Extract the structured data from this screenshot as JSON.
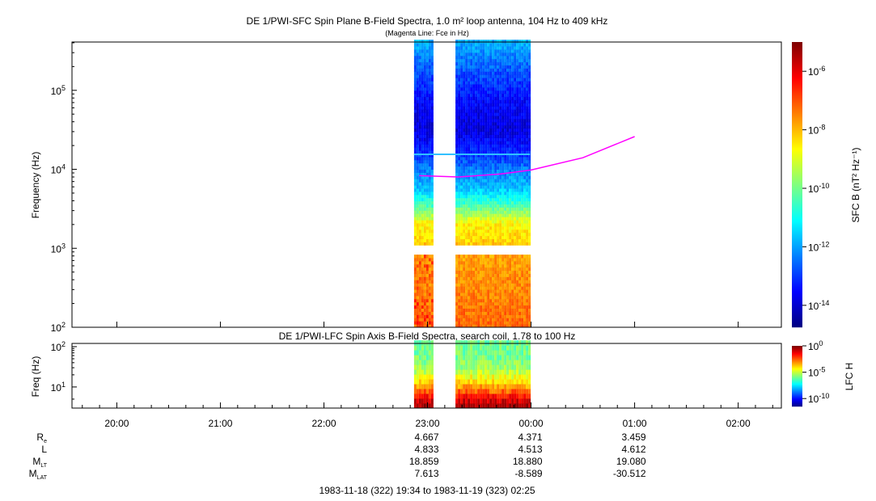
{
  "chart_data": [
    {
      "type": "heatmap",
      "title": "DE 1/PWI-SFC  Spin Plane B-Field Spectra, 1.0 m² loop antenna, 104 Hz to 409 kHz",
      "subtitle": "(Magenta Line: Fce in Hz)",
      "ylabel": "Frequency (Hz)",
      "yscale": "log",
      "ylim": [
        100,
        409000
      ],
      "yticks": [
        {
          "v": 2,
          "label": "10",
          "exp": "2"
        },
        {
          "v": 3,
          "label": "10",
          "exp": "3"
        },
        {
          "v": 4,
          "label": "10",
          "exp": "4"
        },
        {
          "v": 5,
          "label": "10",
          "exp": "5"
        }
      ],
      "colorbar": {
        "label": "SFC B (nT² Hz⁻¹)",
        "log_range": [
          -14.75,
          -5
        ],
        "ticks": [
          {
            "v": -6,
            "label": "10",
            "exp": "-6"
          },
          {
            "v": -8,
            "label": "10",
            "exp": "-8"
          },
          {
            "v": -10,
            "label": "10",
            "exp": "-10"
          },
          {
            "v": -12,
            "label": "10",
            "exp": "-12"
          },
          {
            "v": -14,
            "label": "10",
            "exp": "-14"
          }
        ]
      },
      "data_segments_hours": [
        [
          22.87,
          23.05
        ],
        [
          23.27,
          23.99
        ]
      ],
      "freq_gap_hz": [
        880,
        1070
      ],
      "spectrum_profile_log": [
        [
          2.0,
          -7.2
        ],
        [
          2.5,
          -7.5
        ],
        [
          2.95,
          -7.8
        ],
        [
          3.05,
          -8.2
        ],
        [
          3.3,
          -8.6
        ],
        [
          3.5,
          -10.2
        ],
        [
          3.7,
          -11.5
        ],
        [
          4.0,
          -12.4
        ],
        [
          4.2,
          -13.2
        ],
        [
          4.5,
          -13.9
        ],
        [
          4.8,
          -13.6
        ],
        [
          5.2,
          -12.8
        ],
        [
          5.61,
          -11.8
        ]
      ],
      "fce_line": {
        "name": "Fce",
        "color": "#ff00ff",
        "points_hours_hz": [
          [
            22.92,
            8300
          ],
          [
            23.3,
            8000
          ],
          [
            23.7,
            8700
          ],
          [
            24.0,
            9800
          ],
          [
            24.5,
            14000
          ],
          [
            25.0,
            26000
          ]
        ]
      }
    },
    {
      "type": "heatmap",
      "title": "DE 1/PWI-LFC  Spin Axis B-Field Spectra, search coil, 1.78 to 100 Hz",
      "ylabel": "Freq (Hz)",
      "yscale": "log",
      "ylim": [
        3,
        120
      ],
      "yticks": [
        {
          "v": 1,
          "label": "10",
          "exp": "1"
        },
        {
          "v": 2,
          "label": "10",
          "exp": "2"
        }
      ],
      "colorbar": {
        "label": "LFC H",
        "log_range": [
          -11.5,
          0
        ],
        "ticks": [
          {
            "v": 0,
            "label": "10",
            "exp": "0"
          },
          {
            "v": -5,
            "label": "10",
            "exp": "-5"
          },
          {
            "v": -10,
            "label": "10",
            "exp": "-10"
          }
        ]
      },
      "spectrum_profile_log": [
        [
          0.5,
          -0.5
        ],
        [
          0.7,
          -1.5
        ],
        [
          0.9,
          -3
        ],
        [
          1.1,
          -4
        ],
        [
          1.3,
          -5
        ],
        [
          1.6,
          -5.8
        ],
        [
          2.08,
          -6
        ]
      ]
    }
  ],
  "xaxis": {
    "range_hours": [
      19.567,
      26.417
    ],
    "ticks": [
      {
        "h": 20,
        "label": "20:00"
      },
      {
        "h": 21,
        "label": "21:00"
      },
      {
        "h": 22,
        "label": "22:00"
      },
      {
        "h": 23,
        "label": "23:00"
      },
      {
        "h": 24,
        "label": "00:00"
      },
      {
        "h": 25,
        "label": "01:00"
      },
      {
        "h": 26,
        "label": "02:00"
      }
    ]
  },
  "ephemeris": {
    "rows": [
      {
        "label": "R",
        "sub": "e",
        "values": [
          "4.667",
          "4.371",
          "3.459"
        ]
      },
      {
        "label": "L",
        "sub": "",
        "values": [
          "4.833",
          "4.513",
          "4.612"
        ]
      },
      {
        "label": "M",
        "sub": "LT",
        "values": [
          "18.859",
          "18.880",
          "19.080"
        ]
      },
      {
        "label": "M",
        "sub": "LAT",
        "values": [
          "7.613",
          "-8.589",
          "-30.512"
        ]
      }
    ],
    "at_hours": [
      23,
      24,
      25
    ]
  },
  "time_range": "1983-11-18 (322) 19:34 to 1983-11-19 (323) 02:25"
}
